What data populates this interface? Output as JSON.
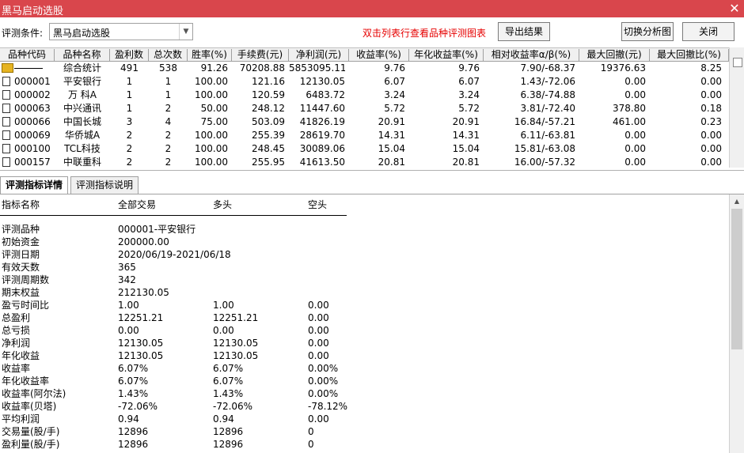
{
  "window": {
    "title": "黑马启动选股",
    "close_label": "✕"
  },
  "toolbar": {
    "label": "评测条件:",
    "combo_value": "黑马启动选股",
    "hint": "双击列表行查看品种评测图表",
    "export_label": "导出结果",
    "switch_label": "切换分析图",
    "close_label": "关闭"
  },
  "table": {
    "columns": [
      "品种代码",
      "品种名称",
      "盈利数",
      "总次数",
      "胜率(%)",
      "手续费(元)",
      "净利润(元)",
      "收益率(%)",
      "年化收益率(%)",
      "相对收益率α/β(%)",
      "最大回撤(元)",
      "最大回撤比(%)"
    ],
    "summary": [
      "",
      "综合统计",
      "491",
      "538",
      "91.26",
      "70208.88",
      "5853095.11",
      "9.76",
      "9.76",
      "7.90/-68.37",
      "19376.63",
      "8.25"
    ],
    "rows": [
      [
        "000001",
        "平安银行",
        "1",
        "1",
        "100.00",
        "121.16",
        "12130.05",
        "6.07",
        "6.07",
        "1.43/-72.06",
        "0.00",
        "0.00"
      ],
      [
        "000002",
        "万 科A",
        "1",
        "1",
        "100.00",
        "120.59",
        "6483.72",
        "3.24",
        "3.24",
        "6.38/-74.88",
        "0.00",
        "0.00"
      ],
      [
        "000063",
        "中兴通讯",
        "1",
        "2",
        "50.00",
        "248.12",
        "11447.60",
        "5.72",
        "5.72",
        "3.81/-72.40",
        "378.80",
        "0.18"
      ],
      [
        "000066",
        "中国长城",
        "3",
        "4",
        "75.00",
        "503.09",
        "41826.19",
        "20.91",
        "20.91",
        "16.84/-57.21",
        "461.00",
        "0.23"
      ],
      [
        "000069",
        "华侨城A",
        "2",
        "2",
        "100.00",
        "255.39",
        "28619.70",
        "14.31",
        "14.31",
        "6.11/-63.81",
        "0.00",
        "0.00"
      ],
      [
        "000100",
        "TCL科技",
        "2",
        "2",
        "100.00",
        "248.45",
        "30089.06",
        "15.04",
        "15.04",
        "15.81/-63.08",
        "0.00",
        "0.00"
      ],
      [
        "000157",
        "中联重科",
        "2",
        "2",
        "100.00",
        "255.95",
        "41613.50",
        "20.81",
        "20.81",
        "16.00/-57.32",
        "0.00",
        "0.00"
      ]
    ]
  },
  "tabs": [
    "评测指标详情",
    "评测指标说明"
  ],
  "detail": {
    "headers": [
      "指标名称",
      "全部交易",
      "多头",
      "空头"
    ],
    "rows": [
      [
        "评测品种",
        "000001-平安银行",
        "",
        ""
      ],
      [
        "初始资金",
        "200000.00",
        "",
        ""
      ],
      [
        "评测日期",
        "2020/06/19-2021/06/18",
        "",
        ""
      ],
      [
        "有效天数",
        "365",
        "",
        ""
      ],
      [
        "评测周期数",
        "342",
        "",
        ""
      ],
      [
        "期末权益",
        "212130.05",
        "",
        ""
      ],
      [
        "盈亏时间比",
        "1.00",
        "1.00",
        "0.00"
      ],
      [
        "总盈利",
        "12251.21",
        "12251.21",
        "0.00"
      ],
      [
        "总亏损",
        "0.00",
        "0.00",
        "0.00"
      ],
      [
        "净利润",
        "12130.05",
        "12130.05",
        "0.00"
      ],
      [
        "年化收益",
        "12130.05",
        "12130.05",
        "0.00"
      ],
      [
        "收益率",
        "6.07%",
        "6.07%",
        "0.00%"
      ],
      [
        "年化收益率",
        "6.07%",
        "6.07%",
        "0.00%"
      ],
      [
        "收益率(阿尔法)",
        "1.43%",
        "1.43%",
        "0.00%"
      ],
      [
        "收益率(贝塔)",
        "-72.06%",
        "-72.06%",
        "-78.12%"
      ],
      [
        "平均利润",
        "0.94",
        "0.94",
        "0.00"
      ],
      [
        "交易量(股/手)",
        "12896",
        "12896",
        "0"
      ],
      [
        "盈利量(股/手)",
        "12896",
        "12896",
        "0"
      ]
    ]
  },
  "colors": {
    "titlebar": "#d9464c",
    "hint": "#e60000"
  }
}
